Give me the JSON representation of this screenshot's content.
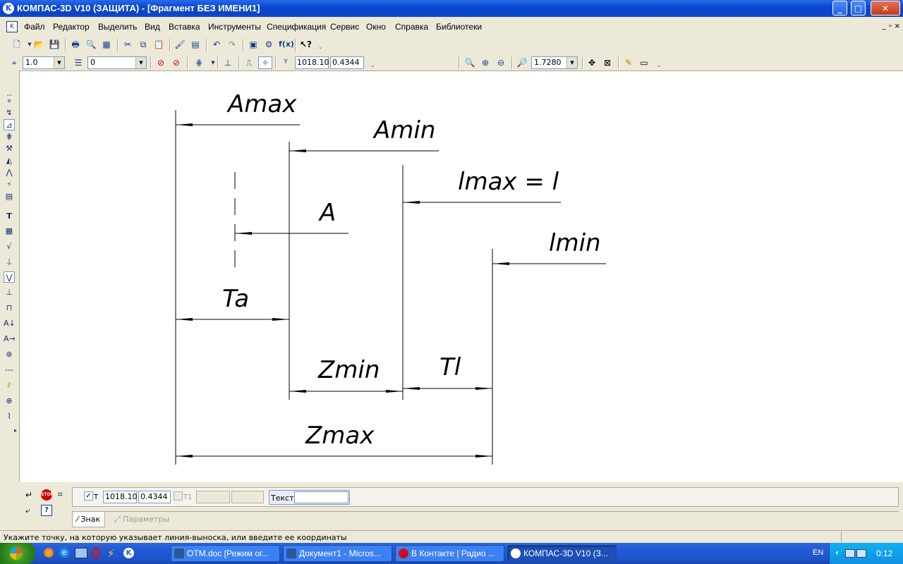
{
  "window": {
    "title": "КОМПАС-3D V10 (ЗАЩИТА) - [Фрагмент БЕЗ ИМЕНИ1]",
    "app_icon": "kompas-icon",
    "controls": {
      "minimize": "_",
      "maximize": "□",
      "close": "✕"
    }
  },
  "menu": {
    "items": [
      "Файл",
      "Редактор",
      "Выделить",
      "Вид",
      "Вставка",
      "Инструменты",
      "Спецификация",
      "Сервис",
      "Окно",
      "Справка",
      "Библиотеки"
    ],
    "doc_controls": {
      "minimize": "_",
      "restore": "▫",
      "close": "×"
    }
  },
  "toolbar_current_state": {
    "step": "1.0",
    "layer": "0",
    "coord_x": "1018.10",
    "coord_y": "0.4344"
  },
  "toolbar_view": {
    "zoom": "1.7280"
  },
  "drawing": {
    "labels": {
      "amax": "Amax",
      "amin": "Amin",
      "lmax": "lmax = l",
      "a": "A",
      "lmin": "lmin",
      "ta": "Ta",
      "zmin": "Zmin",
      "tl": "Tl",
      "zmax": "Zmax"
    }
  },
  "property_panel": {
    "t_label": "T",
    "t_x": "1018.10",
    "t_y": "0.4344",
    "t1_label": "T1",
    "text_label": "Текст",
    "text_value": "",
    "tabs": [
      "Знак",
      "Параметры"
    ]
  },
  "status": {
    "message": "Укажите точку, на которую указывает линия-выноска, или введите ее координаты"
  },
  "taskbar": {
    "tasks": [
      {
        "label": "OTM.doc [Режим ог...",
        "icon_color": "#2b5797",
        "icon": "word-icon"
      },
      {
        "label": "Документ1 - Micros...",
        "icon_color": "#2b5797",
        "icon": "word-icon"
      },
      {
        "label": "В Контакте | Радио ...",
        "icon_color": "#cc0f16",
        "icon": "opera-icon"
      },
      {
        "label": "КОМПАС-3D V10 (З...",
        "icon_color": "#ffffff",
        "icon": "kompas-icon"
      }
    ],
    "language": "EN",
    "clock": "0:12"
  }
}
